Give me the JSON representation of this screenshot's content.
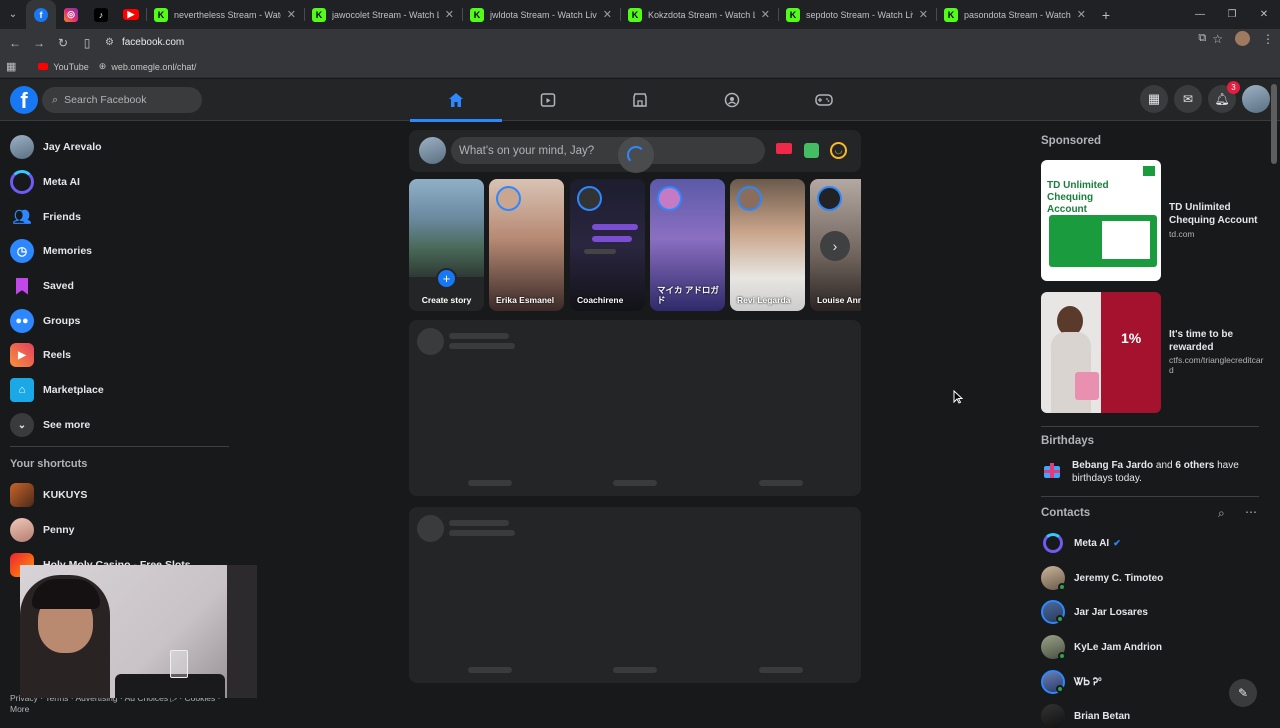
{
  "browser": {
    "tabs": [
      {
        "title": "nevertheless Stream - Watch Live",
        "favicon": "K"
      },
      {
        "title": "jawocolet Stream - Watch Live on",
        "favicon": "K"
      },
      {
        "title": "jwldota Stream - Watch Live on",
        "favicon": "K"
      },
      {
        "title": "Kokzdota Stream - Watch Live",
        "favicon": "K"
      },
      {
        "title": "sepdoto Stream - Watch Live on",
        "favicon": "K"
      },
      {
        "title": "pasondota Stream - Watch Live",
        "favicon": "K"
      }
    ],
    "url": "facebook.com",
    "bookmarks": [
      {
        "label": "YouTube",
        "icon": "youtube-icon"
      },
      {
        "label": "web.omegle.onl/chat/",
        "icon": "globe-icon"
      }
    ]
  },
  "fb_header": {
    "search_placeholder": "Search Facebook",
    "notification_count": "3"
  },
  "left_nav": {
    "items": [
      {
        "label": "Jay Arevalo",
        "icon": "profile-avatar"
      },
      {
        "label": "Meta AI",
        "icon": "meta-ai-icon"
      },
      {
        "label": "Friends",
        "icon": "friends-icon"
      },
      {
        "label": "Memories",
        "icon": "memories-icon"
      },
      {
        "label": "Saved",
        "icon": "saved-icon"
      },
      {
        "label": "Groups",
        "icon": "groups-icon"
      },
      {
        "label": "Reels",
        "icon": "reels-icon"
      },
      {
        "label": "Marketplace",
        "icon": "marketplace-icon"
      },
      {
        "label": "See more",
        "icon": "chevron-down-icon"
      }
    ],
    "shortcuts_title": "Your shortcuts",
    "shortcuts": [
      {
        "label": "KUKUYS"
      },
      {
        "label": "Penny"
      },
      {
        "label": "Holy Moly Casino - Free Slots"
      }
    ],
    "footer": "Privacy · Terms · Advertising · Ad Choices ▷ · Cookies · More"
  },
  "composer": {
    "placeholder": "What's on your mind, Jay?"
  },
  "stories": [
    {
      "name": "Create story"
    },
    {
      "name": "Erika Esmanel"
    },
    {
      "name": "Coachirene"
    },
    {
      "name": "マイカ アドロガド"
    },
    {
      "name": "Revi Legarda"
    },
    {
      "name": "Louise Ann"
    }
  ],
  "right": {
    "sponsored_title": "Sponsored",
    "ads": [
      {
        "title": "TD Unlimited Chequing Account",
        "url": "td.com",
        "image_text": "TD Unlimited Chequing Account"
      },
      {
        "title": "It's time to be rewarded",
        "url": "ctfs.com/trianglecreditcard",
        "image_text": "1%"
      }
    ],
    "birthdays_title": "Birthdays",
    "birthday_name": "Bebang Fa Jardo",
    "birthday_and": "and",
    "birthday_others": "6 others",
    "birthday_suffix": "have birthdays today.",
    "contacts_title": "Contacts",
    "contacts": [
      {
        "name": "Meta AI"
      },
      {
        "name": "Jeremy C. Timoteo"
      },
      {
        "name": "Jar Jar Losares"
      },
      {
        "name": "KyLe Jam Andrion"
      },
      {
        "name": "ᏔᏏ Ꭾº"
      },
      {
        "name": "Brian Betan"
      }
    ]
  },
  "colors": {
    "accent": "#2d88ff",
    "fb_blue": "#1877f2",
    "bg": "#18191a",
    "card": "#242526"
  }
}
